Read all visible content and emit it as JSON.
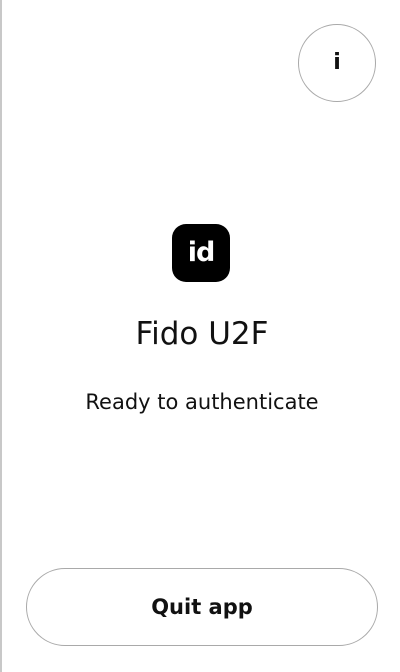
{
  "header": {
    "info_button": {
      "glyph": "i",
      "icon": "info-icon"
    }
  },
  "main": {
    "logo": {
      "text": "id",
      "background_color": "#000000",
      "text_color": "#ffffff"
    },
    "app_name": "Fido U2F",
    "status": "Ready to authenticate"
  },
  "footer": {
    "quit_label": "Quit app"
  },
  "colors": {
    "background": "#ffffff",
    "text": "#111111",
    "border": "#a9a9a9"
  }
}
